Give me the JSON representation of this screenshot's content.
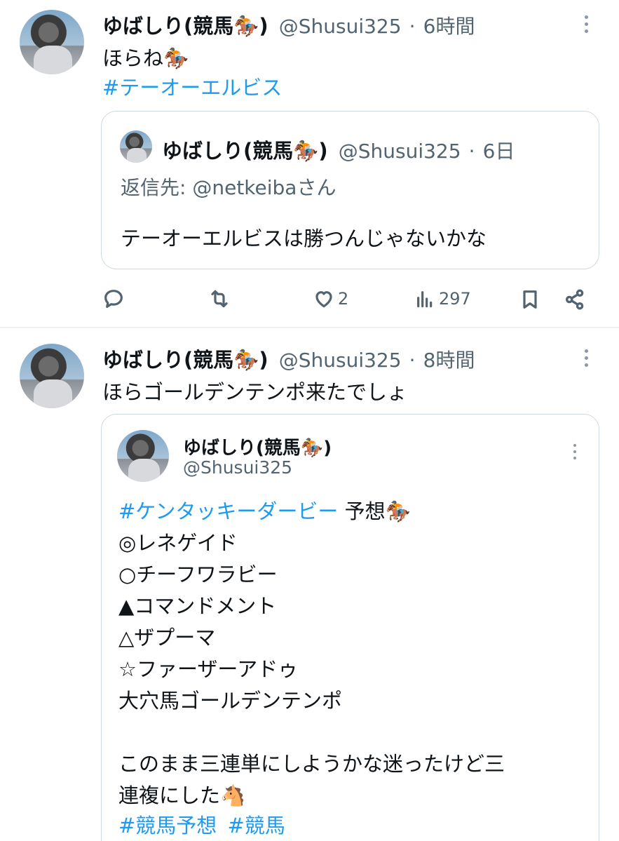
{
  "tweets": [
    {
      "name": "ゆばしり(競馬🏇)",
      "handle": "@Shusui325",
      "sep": "·",
      "time": "6時間",
      "text": "ほらね🏇",
      "hashtag": "#テーオーエルビス",
      "quote": {
        "name": "ゆばしり(競馬🏇)",
        "handle": "@Shusui325",
        "sep": "·",
        "time": "6日",
        "reply_prefix": "返信先: ",
        "reply_to": "@netkeibaさん",
        "text": "テーオーエルビスは勝つんじゃないかな"
      },
      "actions": {
        "reply_count": "",
        "retweet_count": "",
        "like_count": "2",
        "views_count": "297"
      }
    },
    {
      "name": "ゆばしり(競馬🏇)",
      "handle": "@Shusui325",
      "sep": "·",
      "time": "8時間",
      "text": "ほらゴールデンテンポ来たでしょ",
      "quote": {
        "name": "ゆばしり(競馬🏇)",
        "handle": "@Shusui325",
        "hashtag": "#ケンタッキーダービー",
        "title_suffix": " 予想🏇",
        "lines": [
          "◎レネゲイド",
          "○チーフワラビー",
          "▲コマンドメント",
          "△ザプーマ",
          "☆ファーザーアドゥ",
          "大穴馬ゴールデンテンポ"
        ],
        "closing_1": "このまま三連単にしようかな迷ったけど三",
        "closing_2": "連複にした🐴",
        "hashtag_1": "#競馬予想",
        "hashtag_2": "#競馬"
      }
    }
  ],
  "icons": [
    "more-icon",
    "reply-icon",
    "retweet-icon",
    "like-icon",
    "views-icon",
    "bookmark-icon",
    "share-icon"
  ],
  "colors": {
    "accent": "#1d9bf0",
    "secondary_text": "#536471",
    "border": "#cfd9de"
  }
}
